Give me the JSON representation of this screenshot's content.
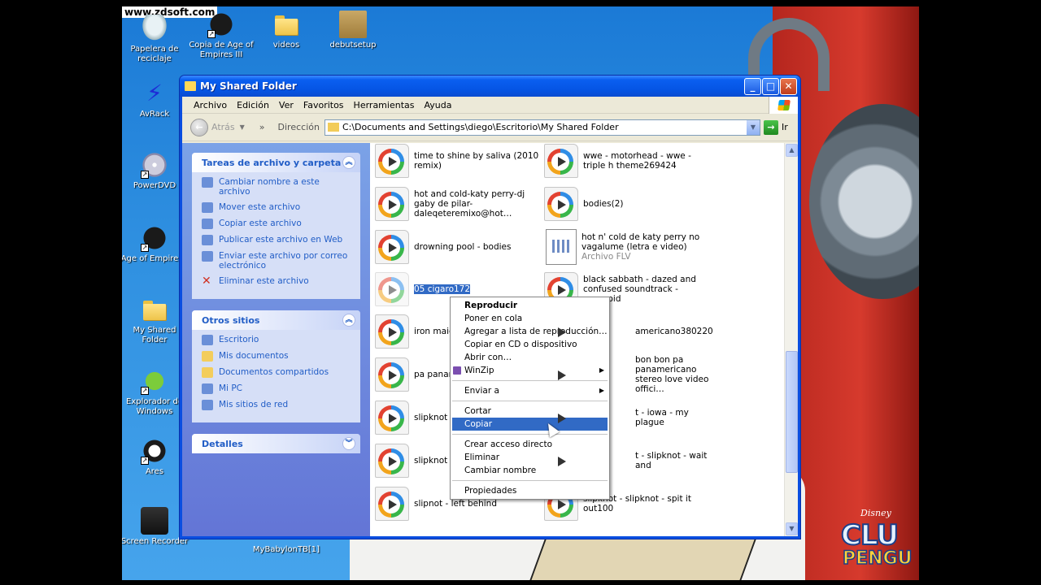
{
  "watermark": "www.zdsoft.com",
  "desktop": {
    "icons": [
      {
        "label": "Papelera de reciclaje",
        "icon": "recycle-bin-icon"
      },
      {
        "label": "Copia de Age of Empires III",
        "icon": "age-of-empires-icon"
      },
      {
        "label": "videos",
        "icon": "folder-icon"
      },
      {
        "label": "debutsetup",
        "icon": "installer-box-icon"
      },
      {
        "label": "AvRack",
        "icon": "avrack-icon"
      },
      {
        "label": "PowerDVD",
        "icon": "dvd-icon"
      },
      {
        "label": "Age of Empire III",
        "icon": "age-of-empires-icon"
      },
      {
        "label": "My Shared Folder",
        "icon": "folder-icon"
      },
      {
        "label": "Explorador de Windows",
        "icon": "explorer-icon"
      },
      {
        "label": "Ares",
        "icon": "ares-icon"
      },
      {
        "label": "Screen Recorder",
        "icon": "camera-icon"
      },
      {
        "label": "MyBabylonTB[1]",
        "icon": "installer-icon"
      }
    ]
  },
  "wallpaper": {
    "brand_top": "Disney",
    "brand_mid": "CLU",
    "brand_bottom": "PENGU"
  },
  "window": {
    "title": "My Shared Folder",
    "controls": {
      "minimize": "_",
      "maximize": "□",
      "close": "✕"
    },
    "menu": [
      "Archivo",
      "Edición",
      "Ver",
      "Favoritos",
      "Herramientas",
      "Ayuda"
    ],
    "toolbar": {
      "back_label": "Atrás",
      "address_label": "Dirección",
      "address_value": "C:\\Documents and Settings\\diego\\Escritorio\\My Shared Folder",
      "go_label": "Ir"
    },
    "taskpane": {
      "file_tasks": {
        "title": "Tareas de archivo y carpeta",
        "items": [
          "Cambiar nombre a este archivo",
          "Mover este archivo",
          "Copiar este archivo",
          "Publicar este archivo en Web",
          "Enviar este archivo por correo electrónico",
          "Eliminar este archivo"
        ]
      },
      "other_places": {
        "title": "Otros sitios",
        "items": [
          "Escritorio",
          "Mis documentos",
          "Documentos compartidos",
          "Mi PC",
          "Mis sitios de red"
        ]
      },
      "details": {
        "title": "Detalles"
      }
    },
    "files": [
      {
        "name": "time to shine by saliva (2010 remix)",
        "type": "wmp"
      },
      {
        "name": "wwe - motorhead - wwe - triple h theme269424",
        "type": "wmp"
      },
      {
        "name": "hot and cold-katy perry-dj gaby de pilar-daleqeteremixo@hot…",
        "type": "wmp"
      },
      {
        "name": "bodies(2)",
        "type": "wmp"
      },
      {
        "name": "drowning pool - bodies",
        "type": "wmp"
      },
      {
        "name": "hot n' cold de katy perry no vagalume (letra e video)",
        "sub": "Archivo FLV",
        "type": "flv"
      },
      {
        "name": "05 cigaro172",
        "type": "wmp",
        "selected": true
      },
      {
        "name": "black sabbath - dazed and confused soundtrack - paranoid",
        "type": "wmp"
      },
      {
        "name": "iron maide",
        "type": "wmp"
      },
      {
        "name": "americano380220",
        "type": "wmp"
      },
      {
        "name": "pa panam",
        "type": "wmp"
      },
      {
        "name": "bon bon pa panamericano stereo love video offici…",
        "type": "wmp"
      },
      {
        "name": "slipknot",
        "type": "wmp"
      },
      {
        "name": "t - iowa - my plague",
        "type": "wmp"
      },
      {
        "name": "slipknot -",
        "type": "wmp"
      },
      {
        "name": "t - slipknot - wait and",
        "type": "wmp"
      },
      {
        "name": "slipnot - left behind",
        "type": "wmp"
      },
      {
        "name": "slipknot - slipknot - spit it out100",
        "type": "wmp"
      }
    ]
  },
  "context_menu": {
    "items": [
      {
        "label": "Reproducir",
        "bold": true
      },
      {
        "label": "Poner en cola"
      },
      {
        "label": "Agregar a lista de reproducción…"
      },
      {
        "label": "Copiar en CD o dispositivo"
      },
      {
        "label": "Abrir con…"
      },
      {
        "label": "WinZip",
        "submenu": true,
        "icon": "winzip-icon"
      },
      {
        "sep": true
      },
      {
        "label": "Enviar a",
        "submenu": true
      },
      {
        "sep": true
      },
      {
        "label": "Cortar"
      },
      {
        "label": "Copiar",
        "highlighted": true
      },
      {
        "sep": true
      },
      {
        "label": "Crear acceso directo"
      },
      {
        "label": "Eliminar"
      },
      {
        "label": "Cambiar nombre"
      },
      {
        "sep": true
      },
      {
        "label": "Propiedades"
      }
    ]
  }
}
